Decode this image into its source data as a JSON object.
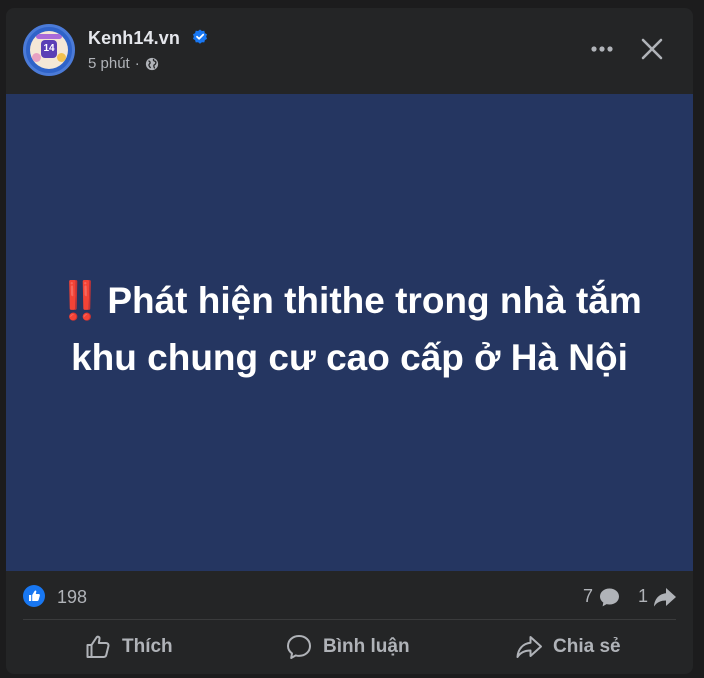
{
  "post": {
    "page_name": "Kenh14.vn",
    "avatar_text": "14",
    "time": "5 phút",
    "separator": "·",
    "headline_mark": "‼️",
    "headline": "Phát hiện thithe trong nhà tắm khu chung cư cao cấp ở Hà Nội"
  },
  "stats": {
    "likes": "198",
    "comments": "7",
    "shares": "1"
  },
  "actions": {
    "like_label": "Thích",
    "comment_label": "Bình luận",
    "share_label": "Chia sẻ"
  },
  "colors": {
    "background": "#242526",
    "media_bg": "#253661",
    "accent": "#1877f2",
    "text_primary": "#e4e6eb",
    "text_secondary": "#b0b3b8"
  },
  "icons": [
    "verified-badge-icon",
    "globe-icon",
    "more-options-icon",
    "close-icon",
    "like-reaction-icon",
    "comment-icon",
    "share-icon",
    "like-icon"
  ]
}
